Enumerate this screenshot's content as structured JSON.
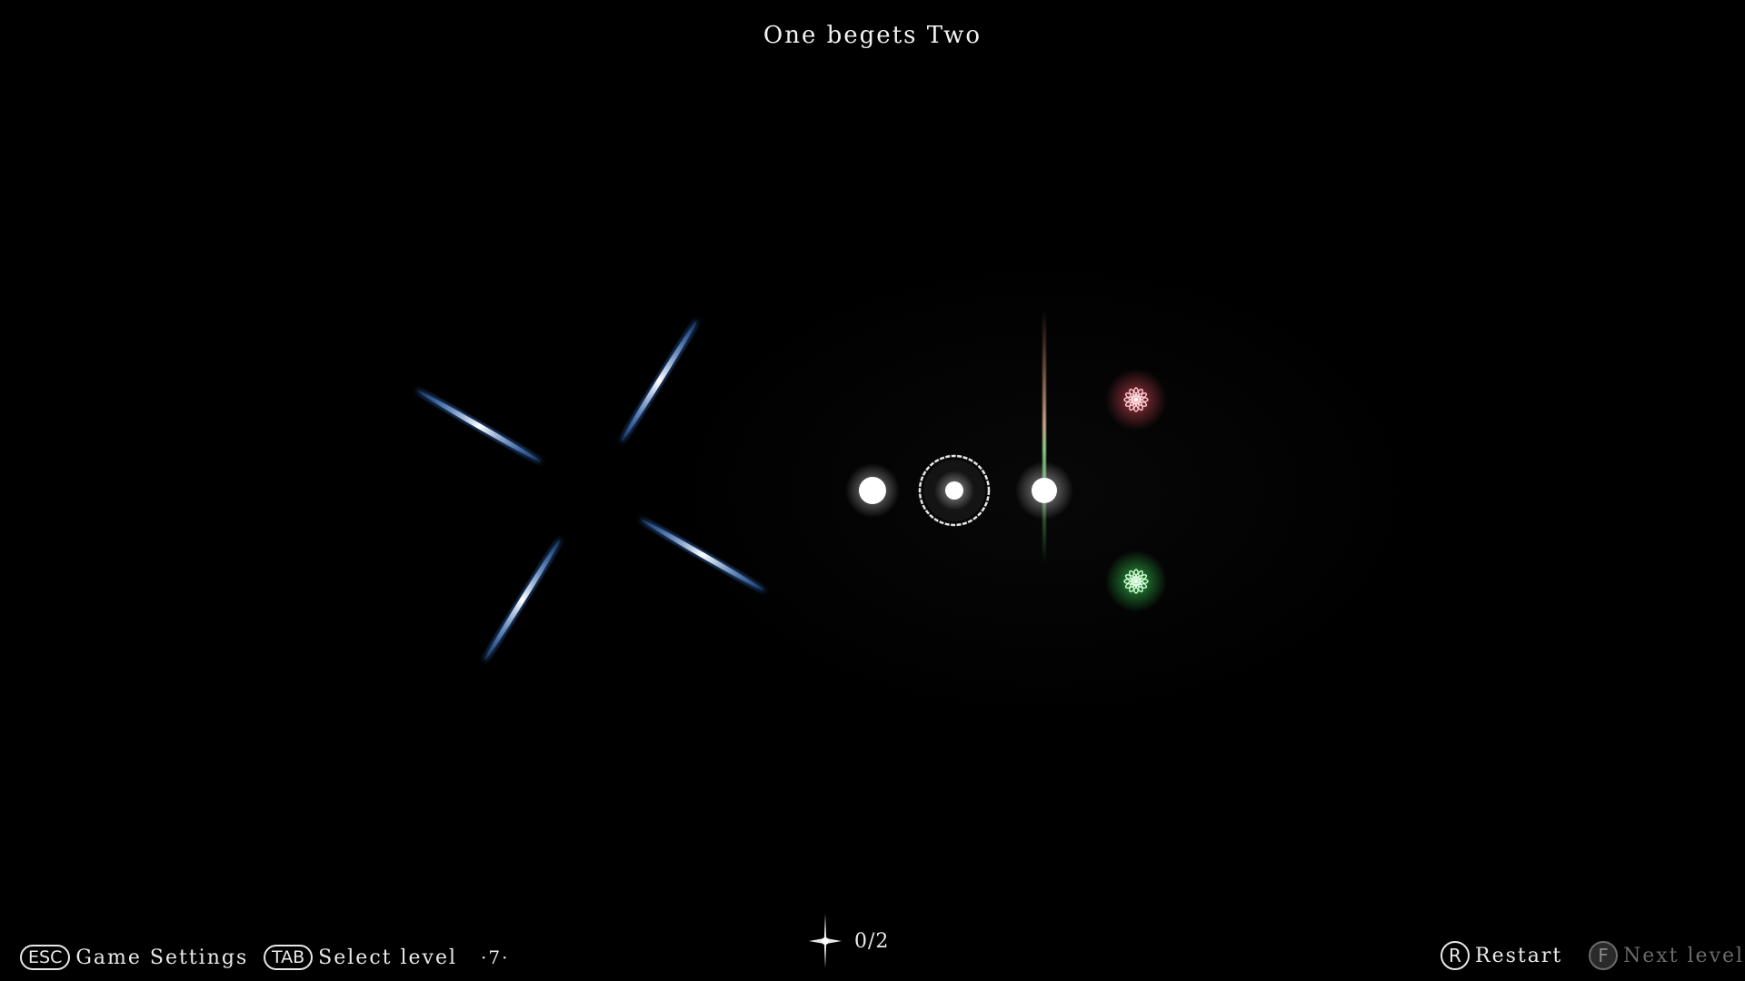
{
  "level": {
    "title": "One begets Two",
    "number": "·7·"
  },
  "hud": {
    "esc_key": "ESC",
    "esc_label": "Game Settings",
    "tab_key": "TAB",
    "tab_label": "Select level",
    "progress": "0/2",
    "progress_collected": 0,
    "progress_total": 2,
    "restart_key": "R",
    "restart_label": "Restart",
    "next_key": "F",
    "next_label": "Next level",
    "next_enabled": false
  },
  "scene": {
    "spinner_color": "#bfe4ff",
    "red_star_color": "#ff6b7a",
    "green_star_color": "#5cff7a",
    "white_orb_color": "#ffffff",
    "icons": [
      "spinning-blades",
      "white-orb",
      "selected-orb-ring",
      "white-orb-flare",
      "red-flower-star",
      "green-flower-star",
      "sparkle-icon"
    ]
  }
}
